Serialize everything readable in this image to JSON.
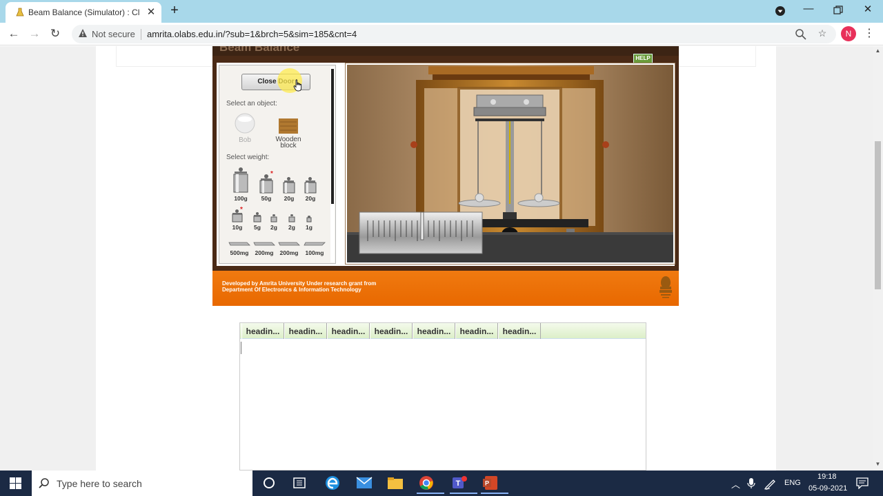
{
  "browser": {
    "tab_title": "Beam Balance (Simulator) : Class",
    "not_secure": "Not secure",
    "url": "amrita.olabs.edu.in/?sub=1&brch=5&sim=185&cnt=4",
    "profile_initial": "N"
  },
  "sim": {
    "title": "Beam Balance",
    "help": "HELP",
    "close_door": "Close Door",
    "select_object": "Select an object:",
    "objects": [
      {
        "label": "Bob"
      },
      {
        "label": "Wooden",
        "label2": "block"
      }
    ],
    "select_weight": "Select weight:",
    "weights_row1": [
      "100g",
      "50g",
      "20g",
      "20g"
    ],
    "weights_row2": [
      "10g",
      "5g",
      "2g",
      "2g",
      "1g"
    ],
    "weights_row3": [
      "500mg",
      "200mg",
      "200mg",
      "100mg"
    ],
    "footer_line1": "Developed by Amrita University Under research grant from",
    "footer_line2": "Department Of Electronics & Information Technology"
  },
  "table": {
    "headers": [
      "headin...",
      "headin...",
      "headin...",
      "headin...",
      "headin...",
      "headin...",
      "headin..."
    ]
  },
  "taskbar": {
    "search_placeholder": "Type here to search",
    "lang": "ENG",
    "time": "19:18",
    "date": "05-09-2021"
  }
}
